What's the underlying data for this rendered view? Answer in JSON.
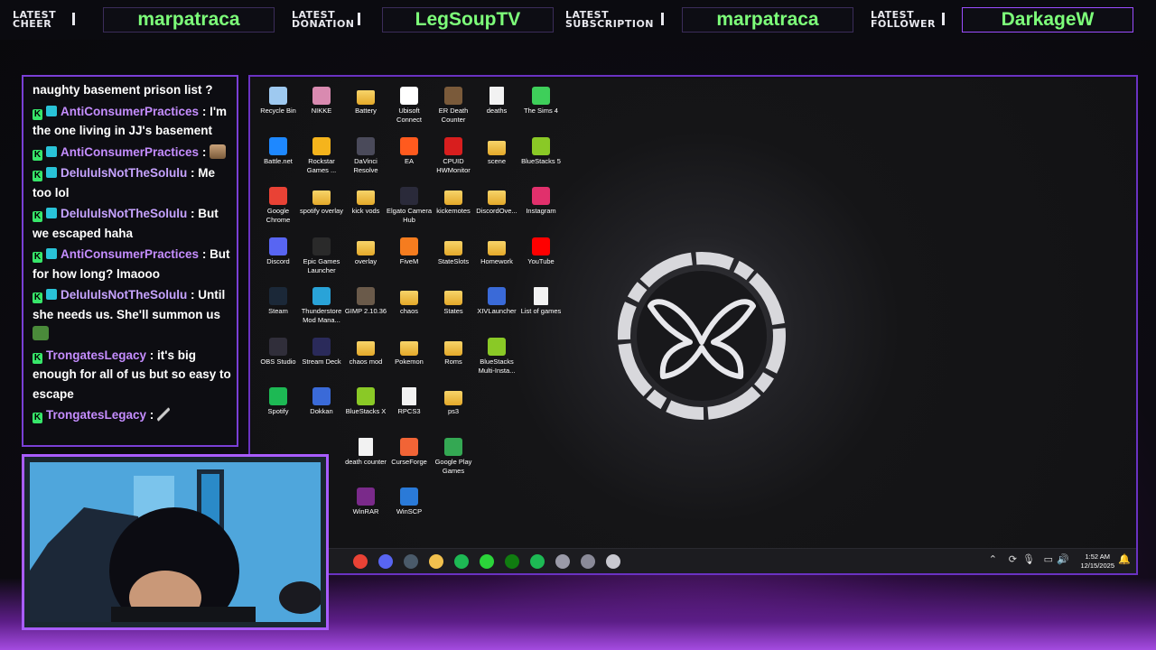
{
  "topbar": {
    "cheer_label": [
      "LATEST",
      "CHEER"
    ],
    "cheer_value": "marpatraca",
    "donation_label": [
      "LATEST",
      "DONATION"
    ],
    "donation_value": "LegSoupTV",
    "subscription_label": [
      "LATEST",
      "SUBSCRIPTION"
    ],
    "subscription_value": "marpatraca",
    "follower_label": [
      "LATEST",
      "FOLLOWER"
    ],
    "follower_value": "DarkageW"
  },
  "chat": {
    "messages": [
      {
        "user": "",
        "text": "naughty basement prison list ?"
      },
      {
        "user": "AntiConsumerPractices",
        "text": "I'm the one living in JJ's basement"
      },
      {
        "user": "AntiConsumerPractices",
        "text": ""
      },
      {
        "user": "DelululsNotTheSolulu",
        "text": "Me too lol"
      },
      {
        "user": "DelululsNotTheSolulu",
        "text": "But we escaped haha"
      },
      {
        "user": "AntiConsumerPractices",
        "text": "But for how long? lmaooo"
      },
      {
        "user": "DelululsNotTheSolulu",
        "text": "Until she needs us. She'll summon us"
      },
      {
        "user": "TrongatesLegacy",
        "text": "it's big enough for all of us but so easy to escape"
      },
      {
        "user": "TrongatesLegacy",
        "text": ""
      }
    ]
  },
  "desktop": {
    "icons": [
      {
        "label": "Recycle Bin",
        "kind": "bin",
        "color": "#9ec9f0"
      },
      {
        "label": "NIKKE",
        "kind": "app",
        "color": "#d98ab0"
      },
      {
        "label": "Battery",
        "kind": "folder",
        "color": "#f2c14e"
      },
      {
        "label": "Ubisoft Connect",
        "kind": "app",
        "color": "#ffffff"
      },
      {
        "label": "ER Death Counter",
        "kind": "app",
        "color": "#7a5a3a"
      },
      {
        "label": "deaths",
        "kind": "doc",
        "color": "#f2f2f2"
      },
      {
        "label": "The Sims 4",
        "kind": "app",
        "color": "#3ecf5a"
      },
      {
        "label": "Battle.net",
        "kind": "app",
        "color": "#1e88ff"
      },
      {
        "label": "Rockstar Games ...",
        "kind": "app",
        "color": "#f5b41c"
      },
      {
        "label": "DaVinci Resolve",
        "kind": "app",
        "color": "#4a4a5a"
      },
      {
        "label": "EA",
        "kind": "app",
        "color": "#ff5a1e"
      },
      {
        "label": "CPUID HWMonitor",
        "kind": "app",
        "color": "#d81e1e"
      },
      {
        "label": "scene",
        "kind": "folder",
        "color": "#f2c14e"
      },
      {
        "label": "BlueStacks 5",
        "kind": "app",
        "color": "#8ac926"
      },
      {
        "label": "Google Chrome",
        "kind": "app",
        "color": "#e94235"
      },
      {
        "label": "spotify overlay",
        "kind": "folder",
        "color": "#f2c14e"
      },
      {
        "label": "kick vods",
        "kind": "folder",
        "color": "#f2c14e"
      },
      {
        "label": "Elgato Camera Hub",
        "kind": "app",
        "color": "#2a2a3a"
      },
      {
        "label": "kickemotes",
        "kind": "folder",
        "color": "#c45a2a"
      },
      {
        "label": "DiscordOve...",
        "kind": "folder",
        "color": "#f2c14e"
      },
      {
        "label": "Instagram",
        "kind": "app",
        "color": "#e1306c"
      },
      {
        "label": "Discord",
        "kind": "app",
        "color": "#5865f2"
      },
      {
        "label": "Epic Games Launcher",
        "kind": "app",
        "color": "#2a2a2a"
      },
      {
        "label": "overlay",
        "kind": "folder",
        "color": "#f2c14e"
      },
      {
        "label": "FiveM",
        "kind": "app",
        "color": "#f57c1f"
      },
      {
        "label": "StateSlots",
        "kind": "folder",
        "color": "#f2c14e"
      },
      {
        "label": "Homework",
        "kind": "folder",
        "color": "#c48a2a"
      },
      {
        "label": "YouTube",
        "kind": "app",
        "color": "#ff0000"
      },
      {
        "label": "Steam",
        "kind": "app",
        "color": "#1b2838"
      },
      {
        "label": "Thunderstore Mod Mana...",
        "kind": "app",
        "color": "#29a3d8"
      },
      {
        "label": "GIMP 2.10.36",
        "kind": "app",
        "color": "#6a5a4a"
      },
      {
        "label": "chaos",
        "kind": "folder",
        "color": "#f2c14e"
      },
      {
        "label": "States",
        "kind": "folder",
        "color": "#f2c14e"
      },
      {
        "label": "XIVLauncher",
        "kind": "app",
        "color": "#3a6ad8"
      },
      {
        "label": "List of games",
        "kind": "doc",
        "color": "#f2f2f2"
      },
      {
        "label": "OBS Studio",
        "kind": "app",
        "color": "#302e3a"
      },
      {
        "label": "Stream Deck",
        "kind": "app",
        "color": "#2a2a5a"
      },
      {
        "label": "chaos mod",
        "kind": "folder",
        "color": "#f2c14e"
      },
      {
        "label": "Pokemon",
        "kind": "folder",
        "color": "#f2c14e"
      },
      {
        "label": "Roms",
        "kind": "folder",
        "color": "#f2c14e"
      },
      {
        "label": "BlueStacks Multi-Insta...",
        "kind": "app",
        "color": "#8ac926"
      },
      {
        "label": "Spotify",
        "kind": "app",
        "color": "#1db954"
      },
      {
        "label": "Dokkan",
        "kind": "app",
        "color": "#3a6ad8"
      },
      {
        "label": "BlueStacks X",
        "kind": "app",
        "color": "#8ac926"
      },
      {
        "label": "RPCS3",
        "kind": "doc",
        "color": "#f2f2f2"
      },
      {
        "label": "ps3",
        "kind": "folder",
        "color": "#f2c14e"
      },
      {
        "label": "death counter",
        "kind": "doc",
        "color": "#f2f2f2"
      },
      {
        "label": "CurseForge",
        "kind": "app",
        "color": "#f16436"
      },
      {
        "label": "Google Play Games",
        "kind": "app",
        "color": "#34a853"
      },
      {
        "label": "WinRAR",
        "kind": "app",
        "color": "#7a2a8a"
      },
      {
        "label": "WinSCP",
        "kind": "app",
        "color": "#2a7ad8"
      }
    ],
    "taskbar_apps": [
      {
        "name": "chrome",
        "color": "#e94235"
      },
      {
        "name": "discord",
        "color": "#5865f2"
      },
      {
        "name": "steam",
        "color": "#4a5a6a"
      },
      {
        "name": "file-explorer",
        "color": "#f2c14e"
      },
      {
        "name": "app-green",
        "color": "#1db954"
      },
      {
        "name": "app-green-2",
        "color": "#2bd43a"
      },
      {
        "name": "xbox",
        "color": "#107c10"
      },
      {
        "name": "spotify",
        "color": "#1db954"
      },
      {
        "name": "app-gray",
        "color": "#9a9aa8"
      },
      {
        "name": "app-gray-2",
        "color": "#8a8a98"
      },
      {
        "name": "obs",
        "color": "#c8c8d0"
      }
    ],
    "clock_time": "1:52 AM",
    "clock_date": "12/15/2025"
  }
}
